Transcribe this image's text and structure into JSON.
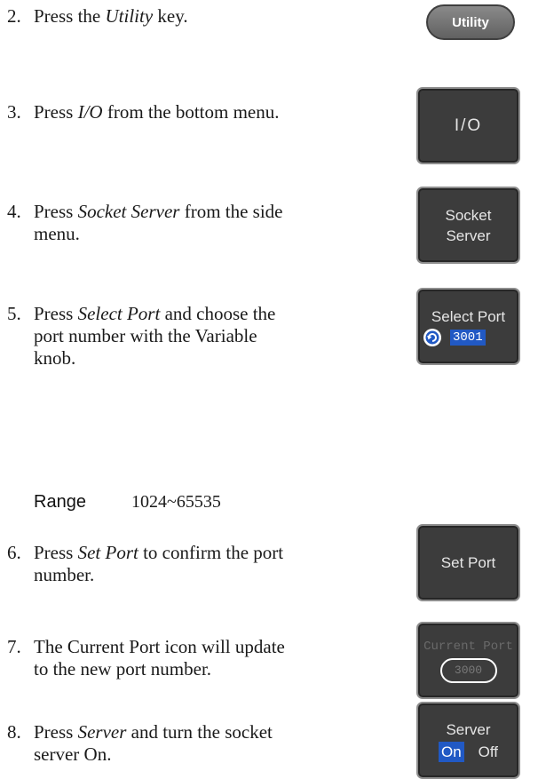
{
  "steps": [
    {
      "num": "2.",
      "lines": [
        [
          "Press the ",
          {
            "i": "Utility"
          },
          " key."
        ]
      ]
    },
    {
      "num": "3.",
      "lines": [
        [
          "Press ",
          {
            "i": "I/O"
          },
          " from the bottom menu."
        ]
      ]
    },
    {
      "num": "4.",
      "lines": [
        [
          "Press ",
          {
            "i": "Socket Server"
          },
          " from the side"
        ],
        [
          "menu."
        ]
      ]
    },
    {
      "num": "5.",
      "lines": [
        [
          "Press ",
          {
            "i": "Select Port"
          },
          " and choose the"
        ],
        [
          "port number with the Variable"
        ],
        [
          "knob."
        ]
      ]
    },
    {
      "num": "6.",
      "lines": [
        [
          "Press ",
          {
            "i": "Set Port"
          },
          " to confirm the port"
        ],
        [
          "number."
        ]
      ]
    },
    {
      "num": "7.",
      "lines": [
        [
          "The Current Port icon will update"
        ],
        [
          "to the new port number."
        ]
      ]
    },
    {
      "num": "8.",
      "lines": [
        [
          "Press ",
          {
            "i": "Server"
          },
          " and turn the socket"
        ],
        [
          "server On."
        ]
      ]
    }
  ],
  "range": {
    "label": "Range",
    "value": "1024~65535"
  },
  "buttons": {
    "utility": "Utility",
    "io": "I/O",
    "socket_server": [
      "Socket",
      "Server"
    ],
    "select_port": {
      "label": "Select Port",
      "value": "3001",
      "icon": "variable-knob-icon"
    },
    "set_port": "Set Port",
    "current_port": {
      "label": "Current Port",
      "value": "3000"
    },
    "server": {
      "label": "Server",
      "on": "On",
      "off": "Off"
    }
  },
  "colors": {
    "highlight": "#2159c4",
    "key_bg": "#3c3c3c"
  }
}
